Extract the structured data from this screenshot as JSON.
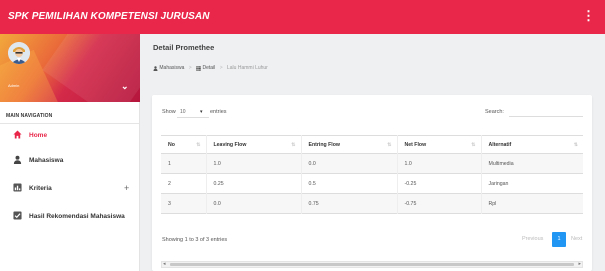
{
  "app": {
    "title": "SPK PEMILIHAN KOMPETENSI JURUSAN",
    "menu_icon": "kebab-menu-icon"
  },
  "colors": {
    "brand": "#e8274a",
    "accent": "#2196f3"
  },
  "user": {
    "name": "Admin"
  },
  "sidebar": {
    "header": "MAIN NAVIGATION",
    "items": [
      {
        "label": "Home",
        "icon": "home-icon",
        "active": true
      },
      {
        "label": "Mahasiswa",
        "icon": "person-icon"
      },
      {
        "label": "Kriteria",
        "icon": "chart-icon",
        "expand": "+"
      },
      {
        "label": "Hasil Rekomendasi Mahasiswa",
        "icon": "checkbox-icon"
      }
    ]
  },
  "page": {
    "title": "Detail Promethee",
    "breadcrumb": [
      "Mahasiswa",
      "Detail",
      "Lalu Hammi Luhur"
    ]
  },
  "table_controls": {
    "show_label": "Show",
    "length_value": "10",
    "entries_label": "entries",
    "search_label": "Search:"
  },
  "table": {
    "headers": [
      "No",
      "Leaving Flow",
      "Entring Flow",
      "Net Flow",
      "Alternatif"
    ],
    "rows": [
      [
        "1",
        "1.0",
        "0.0",
        "1.0",
        "Multimedia"
      ],
      [
        "2",
        "0.25",
        "0.5",
        "-0.25",
        "Jaringan"
      ],
      [
        "3",
        "0.0",
        "0.75",
        "-0.75",
        "Rpl"
      ]
    ]
  },
  "footer": {
    "info": "Showing 1 to 3 of 3 entries",
    "previous": "Previous",
    "page": "1",
    "next": "Next"
  }
}
